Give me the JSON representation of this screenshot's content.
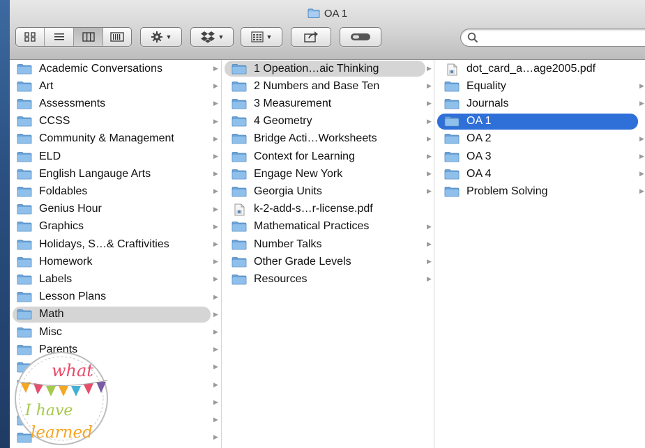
{
  "window": {
    "title": "OA 1"
  },
  "toolbar": {
    "view_modes": [
      "icon-view",
      "list-view",
      "column-view",
      "cover-flow-view"
    ],
    "active_view": 2,
    "action_menu": "gear-icon",
    "arrange_menu": "dropbox-icon",
    "arrange_by": "grid-icon",
    "share": "share-icon",
    "toggle": "toggle-icon",
    "search_placeholder": ""
  },
  "colors": {
    "selection_blue": "#2f6fd8",
    "selection_gray": "#d5d5d5",
    "folder_blue": "#7fb1e0"
  },
  "column1": {
    "items": [
      {
        "label": "Academic Conversations",
        "type": "folder"
      },
      {
        "label": "Art",
        "type": "folder"
      },
      {
        "label": "Assessments",
        "type": "folder"
      },
      {
        "label": "CCSS",
        "type": "folder"
      },
      {
        "label": "Community & Management",
        "type": "folder"
      },
      {
        "label": "ELD",
        "type": "folder"
      },
      {
        "label": "English Langauge Arts",
        "type": "folder"
      },
      {
        "label": "Foldables",
        "type": "folder"
      },
      {
        "label": "Genius Hour",
        "type": "folder"
      },
      {
        "label": "Graphics",
        "type": "folder"
      },
      {
        "label": "Holidays, S…& Craftivities",
        "type": "folder"
      },
      {
        "label": "Homework",
        "type": "folder"
      },
      {
        "label": "Labels",
        "type": "folder"
      },
      {
        "label": "Lesson Plans",
        "type": "folder"
      },
      {
        "label": "Math",
        "type": "folder",
        "selected": "gray"
      },
      {
        "label": "Misc",
        "type": "folder"
      },
      {
        "label": "Parents",
        "type": "folder"
      },
      {
        "label": "",
        "type": "folder"
      },
      {
        "label": "",
        "type": "folder"
      },
      {
        "label": "",
        "type": "folder"
      },
      {
        "label": "",
        "type": "folder"
      },
      {
        "label": "",
        "type": "folder"
      }
    ]
  },
  "column2": {
    "items": [
      {
        "label": "1 Opeation…aic Thinking",
        "type": "folder",
        "selected": "gray"
      },
      {
        "label": "2 Numbers and Base Ten",
        "type": "folder"
      },
      {
        "label": "3 Measurement",
        "type": "folder"
      },
      {
        "label": "4 Geometry",
        "type": "folder"
      },
      {
        "label": "Bridge Acti…Worksheets",
        "type": "folder"
      },
      {
        "label": "Context for Learning",
        "type": "folder"
      },
      {
        "label": "Engage New York",
        "type": "folder"
      },
      {
        "label": "Georgia Units",
        "type": "folder"
      },
      {
        "label": "k-2-add-s…r-license.pdf",
        "type": "file"
      },
      {
        "label": "Mathematical Practices",
        "type": "folder"
      },
      {
        "label": "Number Talks",
        "type": "folder"
      },
      {
        "label": "Other Grade Levels",
        "type": "folder"
      },
      {
        "label": "Resources",
        "type": "folder"
      }
    ]
  },
  "column3": {
    "items": [
      {
        "label": "dot_card_a…age2005.pdf",
        "type": "file"
      },
      {
        "label": "Equality",
        "type": "folder"
      },
      {
        "label": "Journals",
        "type": "folder"
      },
      {
        "label": "OA 1",
        "type": "folder",
        "selected": "blue"
      },
      {
        "label": "OA 2",
        "type": "folder"
      },
      {
        "label": "OA 3",
        "type": "folder"
      },
      {
        "label": "OA 4",
        "type": "folder"
      },
      {
        "label": "Problem Solving",
        "type": "folder"
      }
    ]
  },
  "watermark": {
    "line1": "what",
    "line2": "I have",
    "line3": "learned"
  }
}
